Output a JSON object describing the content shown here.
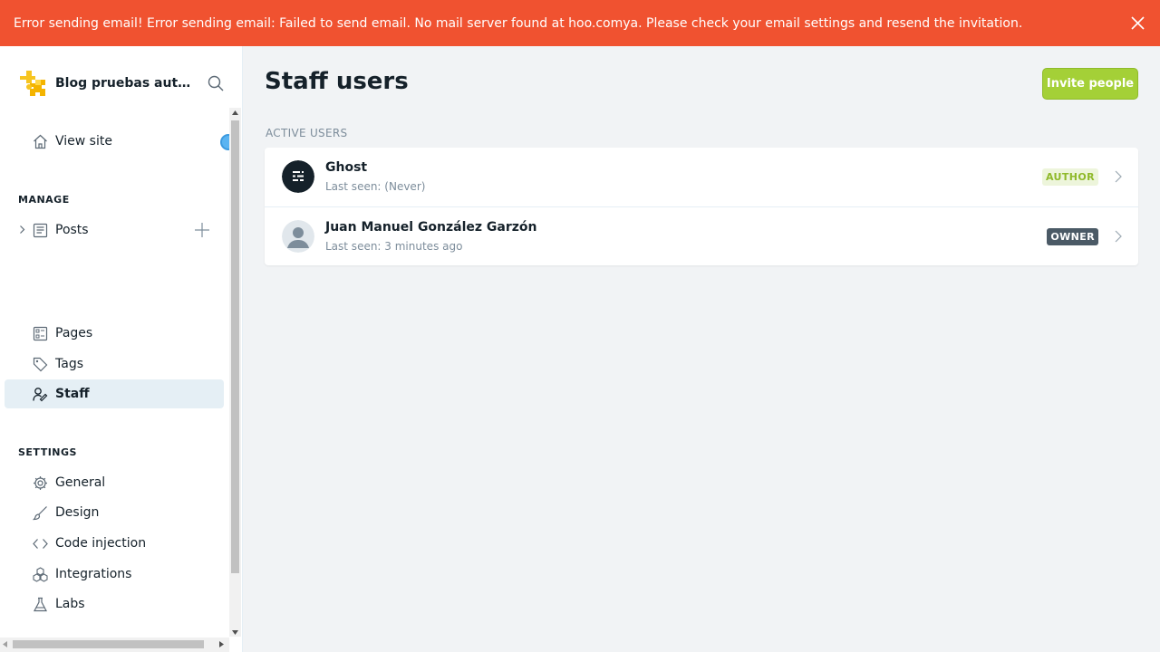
{
  "alert": {
    "message": "Error sending email! Error sending email: Failed to send email. No mail server found at hoo.comya. Please check your email settings and resend the invitation."
  },
  "sidebar": {
    "brand_name": "Blog pruebas auto...",
    "view_site": "View site",
    "manage_title": "MANAGE",
    "posts": "Posts",
    "pages": "Pages",
    "tags": "Tags",
    "staff": "Staff",
    "settings_title": "SETTINGS",
    "general": "General",
    "design": "Design",
    "code_injection": "Code injection",
    "integrations": "Integrations",
    "labs": "Labs"
  },
  "main": {
    "title": "Staff users",
    "invite_button": "Invite people",
    "active_users_label": "ACTIVE USERS",
    "users": [
      {
        "name": "Ghost",
        "last_seen": "Last seen: (Never)",
        "role": "AUTHOR"
      },
      {
        "name": "Juan Manuel González Garzón",
        "last_seen": "Last seen: 3 minutes ago",
        "role": "OWNER"
      }
    ]
  },
  "colors": {
    "alert_bg": "#f05230",
    "accent_green": "#a4d037",
    "owner_badge": "#4b5a66"
  }
}
